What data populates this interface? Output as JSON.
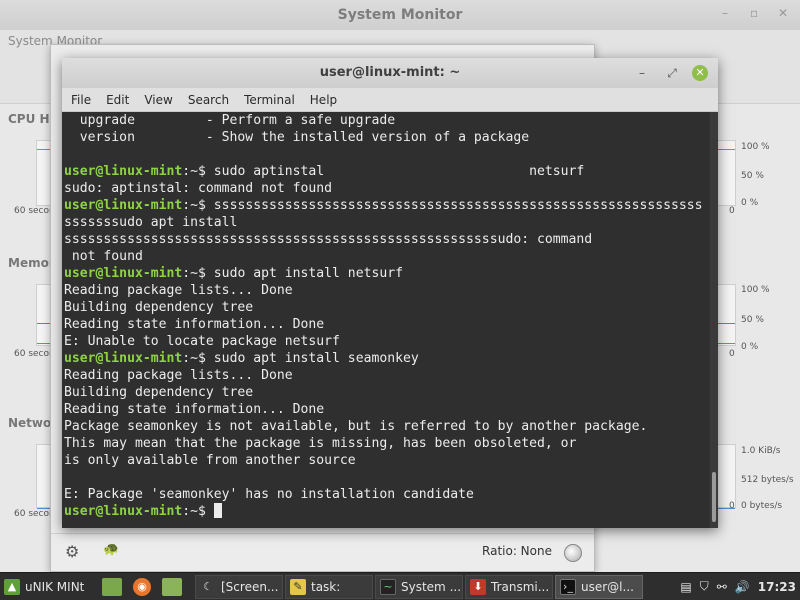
{
  "sysmon": {
    "title": "System Monitor",
    "tab_label": "System Monitor",
    "sections": {
      "cpu": "CPU Hi",
      "memory": "Memor",
      "network": "Netwo"
    },
    "x_label": "60 secon",
    "y_labels_pct": [
      "100 %",
      "50 %",
      "0 %",
      "100 %",
      "50 %",
      "0 %"
    ],
    "y_labels_net": [
      "1.0 KiB/s",
      "512 bytes/s",
      "0 bytes/s"
    ],
    "zero": "0",
    "colors": {
      "cpu_line": "#e06666",
      "mem_line": "#e05555",
      "swap_line": "#55aa55",
      "net_line": "#4a90d9"
    }
  },
  "procdlg": {
    "footer_ratio": "Ratio: None"
  },
  "terminal": {
    "title": "user@linux-mint: ~",
    "menu": [
      "File",
      "Edit",
      "View",
      "Search",
      "Terminal",
      "Help"
    ],
    "lines": [
      {
        "text": "  upgrade         - Perform a safe upgrade"
      },
      {
        "text": "  version         - Show the installed version of a package"
      },
      {
        "text": ""
      },
      {
        "prompt": "user@linux-mint",
        "sep": ":~$ ",
        "text": "sudo aptinstal                          netsurf"
      },
      {
        "text": "sudo: aptinstal: command not found"
      },
      {
        "prompt": "user@linux-mint",
        "sep": ":~$ ",
        "text": "ssssssssssssssssssssssssssssssssssssssssssssssssssssssssssssss"
      },
      {
        "text": "sssssssudo apt install"
      },
      {
        "text": "sssssssssssssssssssssssssssssssssssssssssssssssssssssssudo: command"
      },
      {
        "text": " not found"
      },
      {
        "prompt": "user@linux-mint",
        "sep": ":~$ ",
        "text": "sudo apt install netsurf"
      },
      {
        "text": "Reading package lists... Done"
      },
      {
        "text": "Building dependency tree"
      },
      {
        "text": "Reading state information... Done"
      },
      {
        "text": "E: Unable to locate package netsurf"
      },
      {
        "prompt": "user@linux-mint",
        "sep": ":~$ ",
        "text": "sudo apt install seamonkey"
      },
      {
        "text": "Reading package lists... Done"
      },
      {
        "text": "Building dependency tree"
      },
      {
        "text": "Reading state information... Done"
      },
      {
        "text": "Package seamonkey is not available, but is referred to by another package."
      },
      {
        "text": "This may mean that the package is missing, has been obsoleted, or"
      },
      {
        "text": "is only available from another source"
      },
      {
        "text": ""
      },
      {
        "text": "E: Package 'seamonkey' has no installation candidate"
      },
      {
        "prompt": "user@linux-mint",
        "sep": ":~$ ",
        "text": "",
        "cursor": true
      }
    ]
  },
  "taskbar": {
    "menu_label": "uNIK MINt",
    "windows": [
      {
        "label": "[Screen...",
        "icon": "moon-icon"
      },
      {
        "label": "task:",
        "icon": "note-icon"
      },
      {
        "label": "System ...",
        "icon": "monitor-icon"
      },
      {
        "label": "Transmi...",
        "icon": "transmission-icon"
      },
      {
        "label": "user@l...",
        "icon": "terminal-icon",
        "active": true
      }
    ],
    "clock": "17:23"
  }
}
